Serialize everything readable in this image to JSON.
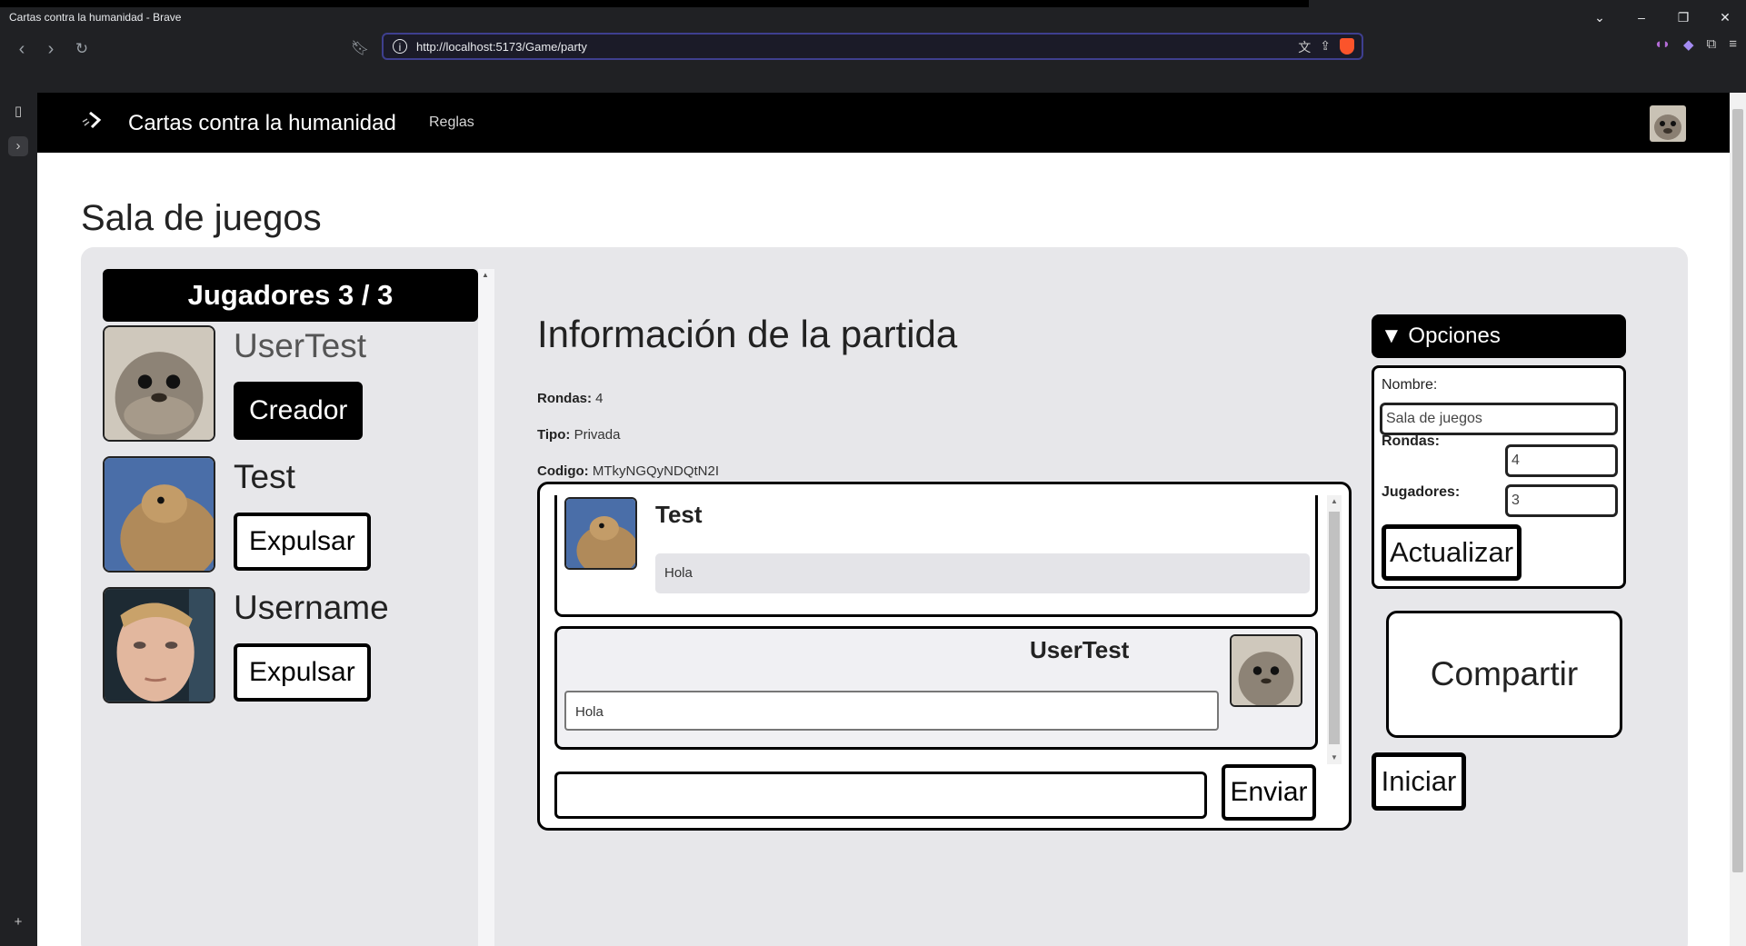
{
  "browser": {
    "window_title": "Cartas contra la humanidad - Brave",
    "url": "http://localhost:5173/Game/party"
  },
  "navbar": {
    "brand": "Cartas contra la humanidad",
    "rules_link": "Reglas"
  },
  "page": {
    "title": "Sala de juegos"
  },
  "players": {
    "header": "Jugadores 3 / 3",
    "list": [
      {
        "name": "UserTest",
        "button": "Creador",
        "role": "creator",
        "avatar": "seal"
      },
      {
        "name": "Test",
        "button": "Expulsar",
        "role": "player",
        "avatar": "prairie-dog"
      },
      {
        "name": "Username",
        "button": "Expulsar",
        "role": "player",
        "avatar": "blinking-guy"
      }
    ]
  },
  "info": {
    "title": "Información de la partida",
    "rounds_label": "Rondas:",
    "rounds_value": "4",
    "type_label": "Tipo:",
    "type_value": "Privada",
    "code_label": "Codigo:",
    "code_value": "MTkyNGQyNDQtN2I"
  },
  "chat": {
    "messages": [
      {
        "author": "Test",
        "text": "Hola",
        "avatar": "prairie-dog"
      },
      {
        "author": "UserTest",
        "text": "Hola",
        "avatar": "seal"
      }
    ],
    "input_value": "",
    "send_label": "Enviar"
  },
  "options": {
    "header": "▼ Opciones",
    "name_label": "Nombre:",
    "name_value": "Sala de juegos",
    "rounds_label": "Rondas:",
    "rounds_value": "4",
    "players_label": "Jugadores:",
    "players_value": "3",
    "update_label": "Actualizar"
  },
  "actions": {
    "share_label": "Compartir",
    "start_label": "Iniciar"
  },
  "colors": {
    "navbar": "#000000",
    "panel": "#e7e7ea",
    "accent_browser": "#fb542b"
  }
}
